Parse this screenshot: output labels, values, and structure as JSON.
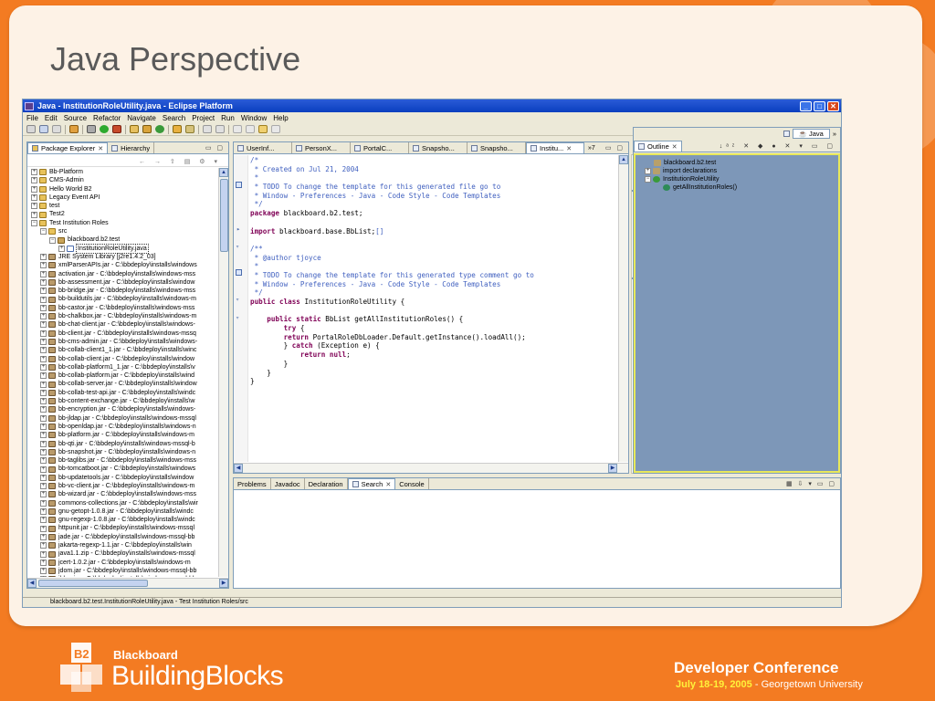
{
  "slide": {
    "title": "Java Perspective",
    "logo_small": "Blackboard",
    "logo_big": "BuildingBlocks",
    "logo_mark": "B2",
    "conference": "Developer Conference",
    "conference_date": "July 18-19, 2005",
    "conference_place": " - Georgetown University"
  },
  "window": {
    "title": "Java - InstitutionRoleUtility.java - Eclipse Platform",
    "controls": {
      "min": "_",
      "max": "□",
      "close": "✕"
    }
  },
  "menu": [
    "File",
    "Edit",
    "Source",
    "Refactor",
    "Navigate",
    "Search",
    "Project",
    "Run",
    "Window",
    "Help"
  ],
  "explorer": {
    "tabs": [
      {
        "label": "Package Explorer",
        "close": "✕"
      },
      {
        "label": "Hierarchy"
      }
    ],
    "items": [
      {
        "label": "Bb-Platform",
        "kind": "proj",
        "indent": 0,
        "exp": "+"
      },
      {
        "label": "CMS-Admin",
        "kind": "proj",
        "indent": 0,
        "exp": "+"
      },
      {
        "label": "Hello World B2",
        "kind": "proj",
        "indent": 0,
        "exp": "+"
      },
      {
        "label": "Legacy Event API",
        "kind": "proj",
        "indent": 0,
        "exp": "+"
      },
      {
        "label": "test",
        "kind": "proj",
        "indent": 0,
        "exp": "+"
      },
      {
        "label": "Test2",
        "kind": "proj",
        "indent": 0,
        "exp": "+"
      },
      {
        "label": "Test Institution Roles",
        "kind": "proj",
        "indent": 0,
        "exp": "−"
      },
      {
        "label": "src",
        "kind": "src",
        "indent": 1,
        "exp": "−"
      },
      {
        "label": "blackboard.b2.test",
        "kind": "pkg",
        "indent": 2,
        "exp": "−"
      },
      {
        "label": "InstitutionRoleUtility.java",
        "kind": "java",
        "indent": 3,
        "exp": "+",
        "selected": true
      },
      {
        "label": "JRE System Library [j2re1.4.2_03]",
        "kind": "jar",
        "indent": 1,
        "exp": "+"
      },
      {
        "label": "xmlParserAPIs.jar - C:\\bbdeploy\\installs\\windows",
        "kind": "jar",
        "indent": 1,
        "exp": "+"
      },
      {
        "label": "activation.jar - C:\\bbdeploy\\installs\\windows-mss",
        "kind": "jar",
        "indent": 1,
        "exp": "+"
      },
      {
        "label": "bb-assessment.jar - C:\\bbdeploy\\installs\\window",
        "kind": "jar",
        "indent": 1,
        "exp": "+"
      },
      {
        "label": "bb-bridge.jar - C:\\bbdeploy\\installs\\windows-mss",
        "kind": "jar",
        "indent": 1,
        "exp": "+"
      },
      {
        "label": "bb-buildutils.jar - C:\\bbdeploy\\installs\\windows-m",
        "kind": "jar",
        "indent": 1,
        "exp": "+"
      },
      {
        "label": "bb-castor.jar - C:\\bbdeploy\\installs\\windows-mss",
        "kind": "jar",
        "indent": 1,
        "exp": "+"
      },
      {
        "label": "bb-chalkbox.jar - C:\\bbdeploy\\installs\\windows-m",
        "kind": "jar",
        "indent": 1,
        "exp": "+"
      },
      {
        "label": "bb-chat-client.jar - C:\\bbdeploy\\installs\\windows-",
        "kind": "jar",
        "indent": 1,
        "exp": "+"
      },
      {
        "label": "bb-client.jar - C:\\bbdeploy\\installs\\windows-mssq",
        "kind": "jar",
        "indent": 1,
        "exp": "+"
      },
      {
        "label": "bb-cms-admin.jar - C:\\bbdeploy\\installs\\windows-",
        "kind": "jar",
        "indent": 1,
        "exp": "+"
      },
      {
        "label": "bb-collab-client1_1.jar - C:\\bbdeploy\\installs\\winc",
        "kind": "jar",
        "indent": 1,
        "exp": "+"
      },
      {
        "label": "bb-collab-client.jar - C:\\bbdeploy\\installs\\window",
        "kind": "jar",
        "indent": 1,
        "exp": "+"
      },
      {
        "label": "bb-collab-platform1_1.jar - C:\\bbdeploy\\installs\\v",
        "kind": "jar",
        "indent": 1,
        "exp": "+"
      },
      {
        "label": "bb-collab-platform.jar - C:\\bbdeploy\\installs\\wind",
        "kind": "jar",
        "indent": 1,
        "exp": "+"
      },
      {
        "label": "bb-collab-server.jar - C:\\bbdeploy\\installs\\window",
        "kind": "jar",
        "indent": 1,
        "exp": "+"
      },
      {
        "label": "bb-collab-test-api.jar - C:\\bbdeploy\\installs\\windc",
        "kind": "jar",
        "indent": 1,
        "exp": "+"
      },
      {
        "label": "bb-content-exchange.jar - C:\\bbdeploy\\installs\\w",
        "kind": "jar",
        "indent": 1,
        "exp": "+"
      },
      {
        "label": "bb-encryption.jar - C:\\bbdeploy\\installs\\windows-",
        "kind": "jar",
        "indent": 1,
        "exp": "+"
      },
      {
        "label": "bb-jldap.jar - C:\\bbdeploy\\installs\\windows-mssql",
        "kind": "jar",
        "indent": 1,
        "exp": "+"
      },
      {
        "label": "bb-openldap.jar - C:\\bbdeploy\\installs\\windows-n",
        "kind": "jar",
        "indent": 1,
        "exp": "+"
      },
      {
        "label": "bb-platform.jar - C:\\bbdeploy\\installs\\windows-m",
        "kind": "jar",
        "indent": 1,
        "exp": "+"
      },
      {
        "label": "bb-qti.jar - C:\\bbdeploy\\installs\\windows-mssql-b",
        "kind": "jar",
        "indent": 1,
        "exp": "+"
      },
      {
        "label": "bb-snapshot.jar - C:\\bbdeploy\\installs\\windows-n",
        "kind": "jar",
        "indent": 1,
        "exp": "+"
      },
      {
        "label": "bb-taglibs.jar - C:\\bbdeploy\\installs\\windows-mss",
        "kind": "jar",
        "indent": 1,
        "exp": "+"
      },
      {
        "label": "bb-tomcatboot.jar - C:\\bbdeploy\\installs\\windows",
        "kind": "jar",
        "indent": 1,
        "exp": "+"
      },
      {
        "label": "bb-updatetools.jar - C:\\bbdeploy\\installs\\window",
        "kind": "jar",
        "indent": 1,
        "exp": "+"
      },
      {
        "label": "bb-vc-client.jar - C:\\bbdeploy\\installs\\windows-m",
        "kind": "jar",
        "indent": 1,
        "exp": "+"
      },
      {
        "label": "bb-wizard.jar - C:\\bbdeploy\\installs\\windows-mss",
        "kind": "jar",
        "indent": 1,
        "exp": "+"
      },
      {
        "label": "commons-collections.jar - C:\\bbdeploy\\installs\\wir",
        "kind": "jar",
        "indent": 1,
        "exp": "+"
      },
      {
        "label": "gnu-getopt-1.0.8.jar - C:\\bbdeploy\\installs\\windc",
        "kind": "jar",
        "indent": 1,
        "exp": "+"
      },
      {
        "label": "gnu-regexp-1.0.8.jar - C:\\bbdeploy\\installs\\windc",
        "kind": "jar",
        "indent": 1,
        "exp": "+"
      },
      {
        "label": "httpunit.jar - C:\\bbdeploy\\installs\\windows-mssql",
        "kind": "jar",
        "indent": 1,
        "exp": "+"
      },
      {
        "label": "jade.jar - C:\\bbdeploy\\installs\\windows-mssql-bb",
        "kind": "jar",
        "indent": 1,
        "exp": "+"
      },
      {
        "label": "jakarta-regexp-1.1.jar - C:\\bbdeploy\\installs\\win",
        "kind": "jar",
        "indent": 1,
        "exp": "+"
      },
      {
        "label": "java1.1.zip - C:\\bbdeploy\\installs\\windows-mssql",
        "kind": "jar",
        "indent": 1,
        "exp": "+"
      },
      {
        "label": "jcert-1.0.2.jar - C:\\bbdeploy\\installs\\windows-m",
        "kind": "jar",
        "indent": 1,
        "exp": "+"
      },
      {
        "label": "jdom.jar - C:\\bbdeploy\\installs\\windows-mssql-bb",
        "kind": "jar",
        "indent": 1,
        "exp": "+"
      },
      {
        "label": "jldap.jar - C:\\bbdeploy\\installs\\windows-mssql-bb",
        "kind": "jar",
        "indent": 1,
        "exp": "+"
      }
    ]
  },
  "editor": {
    "tabs": [
      "UserInf...",
      "PersonX...",
      "PortalC...",
      "Snapsho...",
      "Snapsho...",
      "Institu..."
    ],
    "tabs_overflow": "»7",
    "lines": [
      [
        [
          "cm",
          "/*"
        ]
      ],
      [
        [
          "cm",
          " * Created on Jul 21, 2004"
        ]
      ],
      [
        [
          "cm",
          " *"
        ]
      ],
      [
        [
          "cm",
          " * TODO To change the template for this generated file go to"
        ]
      ],
      [
        [
          "cm",
          " * Window - Preferences - Java - Code Style - Code Templates"
        ]
      ],
      [
        [
          "cm",
          " */"
        ]
      ],
      [
        [
          "kw",
          "package"
        ],
        [
          "tx",
          " blackboard.b2.test;"
        ]
      ],
      [
        [
          "tx",
          ""
        ]
      ],
      [
        [
          "kw",
          "import"
        ],
        [
          "tx",
          " blackboard.base.BbList;"
        ],
        [
          "cm",
          "[]"
        ]
      ],
      [
        [
          "tx",
          ""
        ]
      ],
      [
        [
          "cm",
          "/**"
        ]
      ],
      [
        [
          "cm",
          " * @author tjoyce"
        ]
      ],
      [
        [
          "cm",
          " *"
        ]
      ],
      [
        [
          "cm",
          " * TODO To change the template for this generated type comment go to"
        ]
      ],
      [
        [
          "cm",
          " * Window - Preferences - Java - Code Style - Code Templates"
        ]
      ],
      [
        [
          "cm",
          " */"
        ]
      ],
      [
        [
          "kw",
          "public class"
        ],
        [
          "tx",
          " InstitutionRoleUtility {"
        ]
      ],
      [
        [
          "tx",
          ""
        ]
      ],
      [
        [
          "tx",
          "    "
        ],
        [
          "kw",
          "public static"
        ],
        [
          "tx",
          " BbList getAllInstitutionRoles() {"
        ]
      ],
      [
        [
          "tx",
          "        "
        ],
        [
          "kw",
          "try"
        ],
        [
          "tx",
          " {"
        ]
      ],
      [
        [
          "tx",
          "        "
        ],
        [
          "kw",
          "return"
        ],
        [
          "tx",
          " PortalRoleDbLoader.Default.getInstance().loadAll();"
        ]
      ],
      [
        [
          "tx",
          "        } "
        ],
        [
          "kw",
          "catch"
        ],
        [
          "tx",
          " (Exception e) {"
        ]
      ],
      [
        [
          "tx",
          "            "
        ],
        [
          "kw",
          "return null"
        ],
        [
          "tx",
          ";"
        ]
      ],
      [
        [
          "tx",
          "        }"
        ]
      ],
      [
        [
          "tx",
          "    }"
        ]
      ],
      [
        [
          "tx",
          "}"
        ]
      ]
    ]
  },
  "outline": {
    "perspective_label": "Java",
    "tab": "Outline",
    "items": [
      {
        "label": "blackboard.b2.test",
        "indent": 1
      },
      {
        "label": "import declarations",
        "indent": 0,
        "exp": "+"
      },
      {
        "label": "InstitutionRoleUtility",
        "indent": 0,
        "exp": "−"
      },
      {
        "label": "getAllInstitutionRoles()",
        "indent": 2
      }
    ]
  },
  "bottom": {
    "tabs": [
      "Problems",
      "Javadoc",
      "Declaration",
      "Search",
      "Console"
    ],
    "active_index": 3
  },
  "status": {
    "text": "blackboard.b2.test.InstitutionRoleUtility.java - Test Institution Roles/src"
  },
  "colors": {
    "slide_orange": "#f37b22",
    "titlebar_blue": "#0a3fbf",
    "outline_bg": "#7d97b8",
    "keyword": "#7f0055",
    "comment": "#3f5fbf"
  }
}
